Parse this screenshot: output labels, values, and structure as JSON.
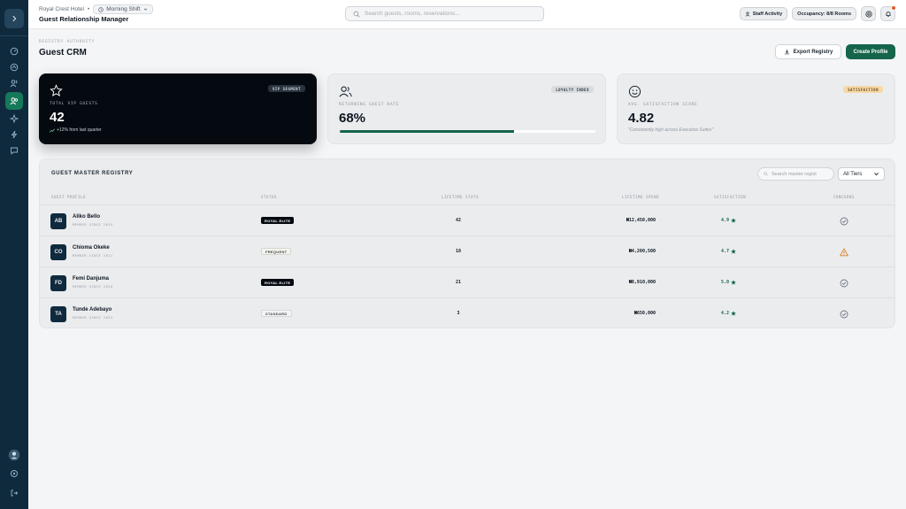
{
  "header": {
    "hotel": "Royal Crest Hotel",
    "separator": "•",
    "shift": "Morning Shift",
    "title": "Guest Relationship Manager",
    "search_placeholder": "Search guests, rooms, reservations...",
    "staff_activity": "Staff Activity",
    "occupancy": "Occupancy: 8/8 Rooms"
  },
  "page": {
    "eyebrow": "REGISTRY AUTHORITY",
    "title": "Guest CRM",
    "export_label": "Export Registry",
    "create_label": "Create Profile"
  },
  "cards": {
    "vip": {
      "badge": "VIP SEGMENT",
      "label": "TOTAL VIP GUESTS",
      "value": "42",
      "sub": "+12% from last quarter"
    },
    "loyalty": {
      "badge": "LOYALTY INDEX",
      "label": "RETURNING GUEST RATE",
      "value": "68%",
      "progress": 68
    },
    "satisfaction": {
      "badge": "SATISFACTION",
      "label": "AVG. SATISFACTION SCORE",
      "value": "4.82",
      "sub": "\"Consistently high across Executive Suites\""
    }
  },
  "registry": {
    "title": "GUEST MASTER REGISTRY",
    "search_placeholder": "Search master regist",
    "tier_filter": "All Tiers",
    "columns": [
      "GUEST PROFILE",
      "STATUS",
      "LIFETIME STAYS",
      "LIFETIME SPEND",
      "SATISFACTION",
      "CONCERNS"
    ],
    "rows": [
      {
        "initials": "AB",
        "name": "Aliko Bello",
        "since": "MEMBER SINCE 2019",
        "status": "ROYAL ELITE",
        "status_type": "elite",
        "stays": "42",
        "spend": "₦12,450,000",
        "satisfaction": "4.9",
        "concern": "ok"
      },
      {
        "initials": "CO",
        "name": "Chioma Okeke",
        "since": "MEMBER SINCE 2021",
        "status": "FREQUENT",
        "status_type": "freq",
        "stays": "18",
        "spend": "₦4,200,500",
        "satisfaction": "4.7",
        "concern": "warning"
      },
      {
        "initials": "FD",
        "name": "Femi Danjuma",
        "since": "MEMBER SINCE 2020",
        "status": "ROYAL ELITE",
        "status_type": "elite",
        "stays": "21",
        "spend": "₦8,910,000",
        "satisfaction": "5.0",
        "concern": "ok"
      },
      {
        "initials": "TA",
        "name": "Tunde Adebayo",
        "since": "MEMBER SINCE 2023",
        "status": "STANDARD",
        "status_type": "std",
        "stays": "3",
        "spend": "₦650,000",
        "satisfaction": "4.2",
        "concern": "ok"
      }
    ]
  },
  "colors": {
    "sidebar": "#0f2a3d",
    "accent": "#15654b",
    "warning": "#d9822b",
    "badge_satisfaction": "#f7d9a8"
  },
  "icons": {
    "sidebar": [
      "chevron-right-icon",
      "dashboard-icon",
      "building-icon",
      "users-icon",
      "guest-crm-icon",
      "sparkle-icon",
      "bolt-icon",
      "message-icon",
      "user-circle-icon",
      "settings-icon",
      "logout-icon"
    ]
  }
}
